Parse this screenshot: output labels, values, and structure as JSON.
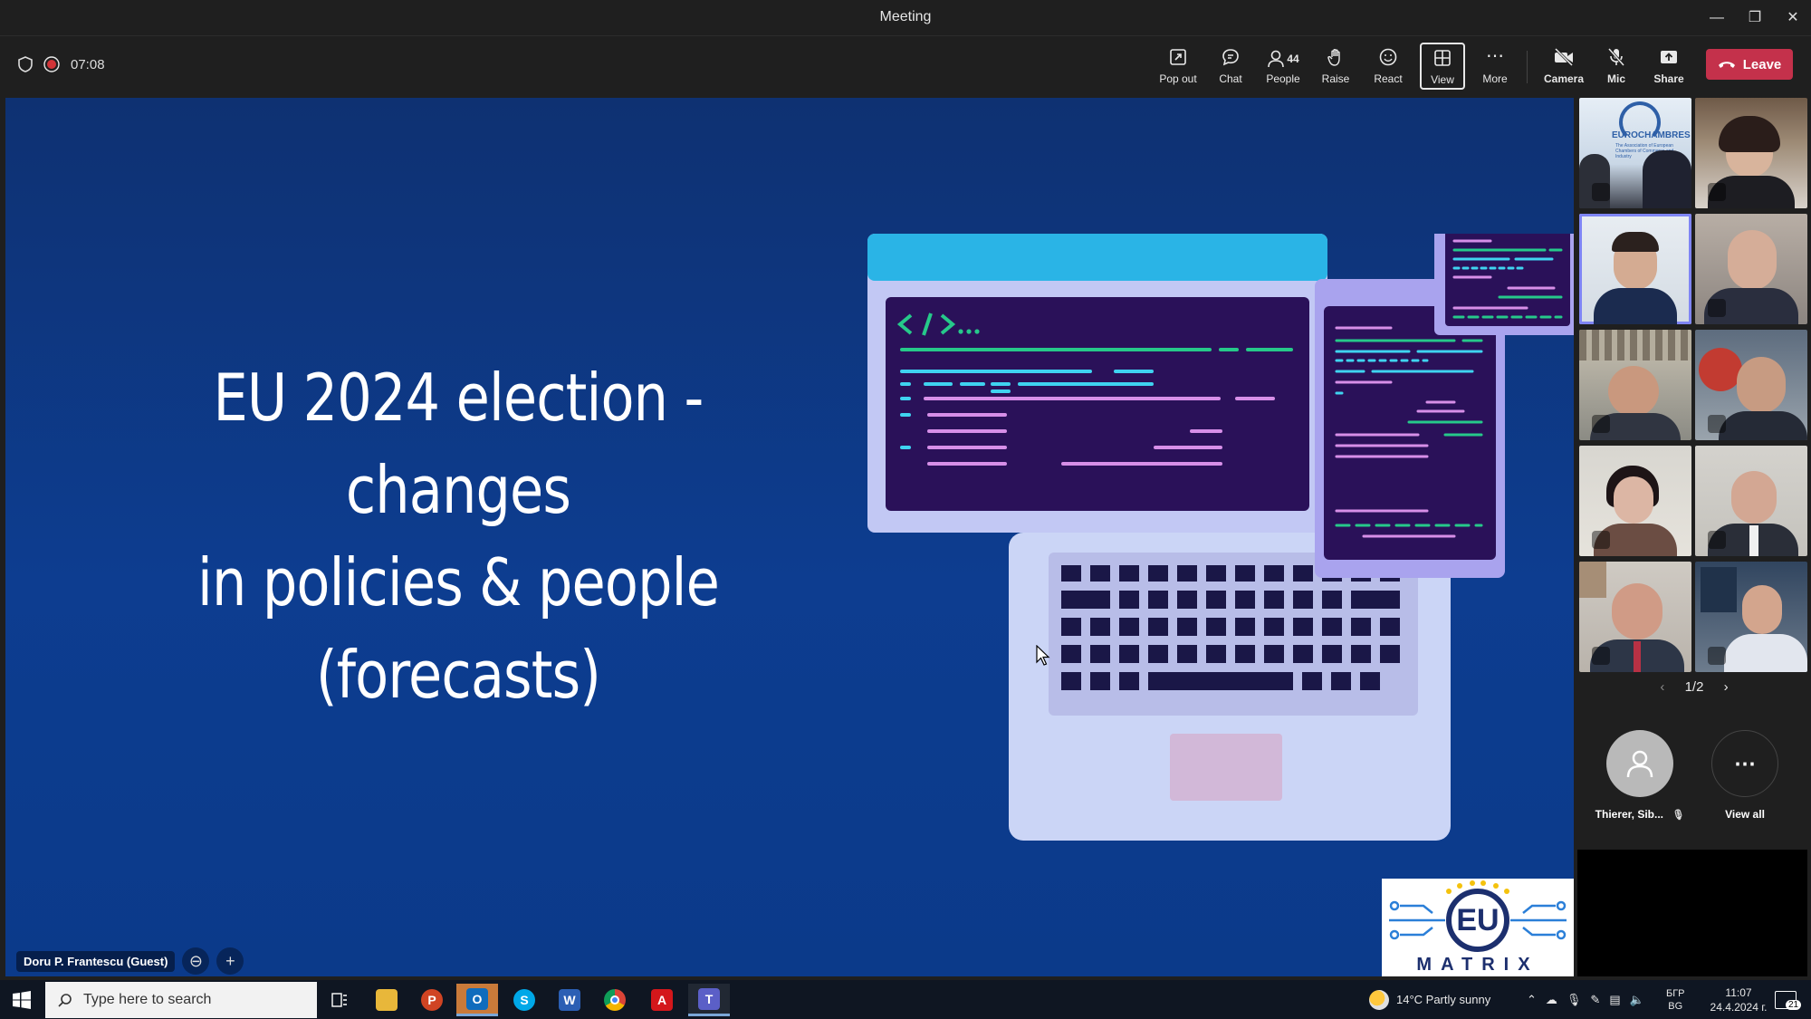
{
  "window": {
    "title": "Meeting",
    "minimize_icon": "minimize-icon",
    "restore_icon": "restore-icon",
    "close_icon": "close-icon"
  },
  "meeting": {
    "timer": "07:08"
  },
  "toolbar": {
    "popout": "Pop out",
    "chat": "Chat",
    "people_label": "People",
    "people_count": "44",
    "raise": "Raise",
    "react": "React",
    "view": "View",
    "more": "More",
    "camera": "Camera",
    "mic": "Mic",
    "share": "Share",
    "leave": "Leave"
  },
  "slide": {
    "title_line1": "EU 2024 election - changes",
    "title_line2": "in policies & people",
    "title_line3": "(forecasts)",
    "logo_text_top": "EU",
    "logo_text_bottom": "MATRIX"
  },
  "presenter": {
    "name": "Doru P. Frantescu (Guest)"
  },
  "gallery": {
    "tile_logo_text_1": "EUROCHAMBRES",
    "tile_logo_text_2": "The Association of European Chambers of Commerce and Industry",
    "pager": "1/2",
    "participant_name": "Thierer, Sib...",
    "view_all": "View all"
  },
  "taskbar": {
    "search_placeholder": "Type here to search",
    "weather": "14°C  Partly sunny",
    "lang_top": "БГР",
    "lang_bottom": "BG",
    "time": "11:07",
    "date": "24.4.2024 г.",
    "notifications": "21"
  },
  "colors": {
    "leave": "#c4314b",
    "accent": "#7f85f5",
    "slide_bg": "#0d3d90",
    "code_green": "#26c98a",
    "code_pink": "#d78fe8",
    "code_cyan": "#3fd3f0"
  }
}
